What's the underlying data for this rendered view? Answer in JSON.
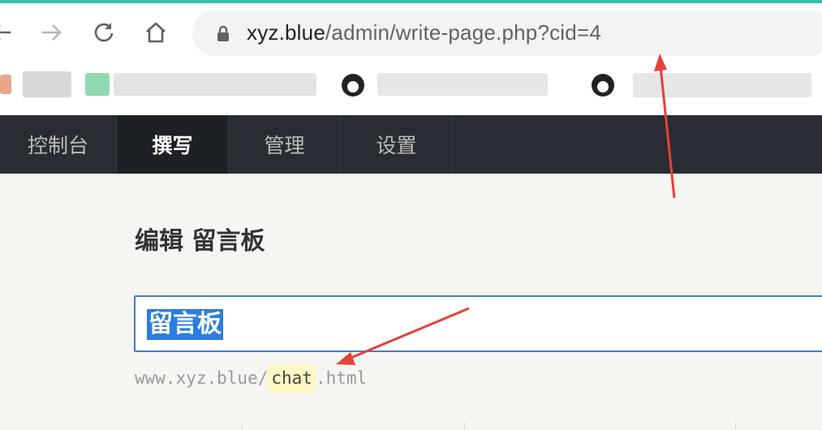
{
  "browser": {
    "url_host": "xyz.blue",
    "url_path": "/admin/write-page.php?cid=4",
    "accent_color": "#35c1b4"
  },
  "nav": {
    "items": [
      {
        "label": "控制台",
        "active": false
      },
      {
        "label": "撰写",
        "active": true
      },
      {
        "label": "管理",
        "active": false
      },
      {
        "label": "设置",
        "active": false
      }
    ],
    "bg_color": "#292d33"
  },
  "page": {
    "heading": "编辑 留言板",
    "title_value": "留言板",
    "slug_prefix": "www.xyz.blue/",
    "slug_value": "chat",
    "slug_suffix": ".html"
  },
  "icons": [
    "back-arrow-icon",
    "forward-arrow-icon",
    "reload-icon",
    "home-icon",
    "lock-icon",
    "github-icon"
  ]
}
